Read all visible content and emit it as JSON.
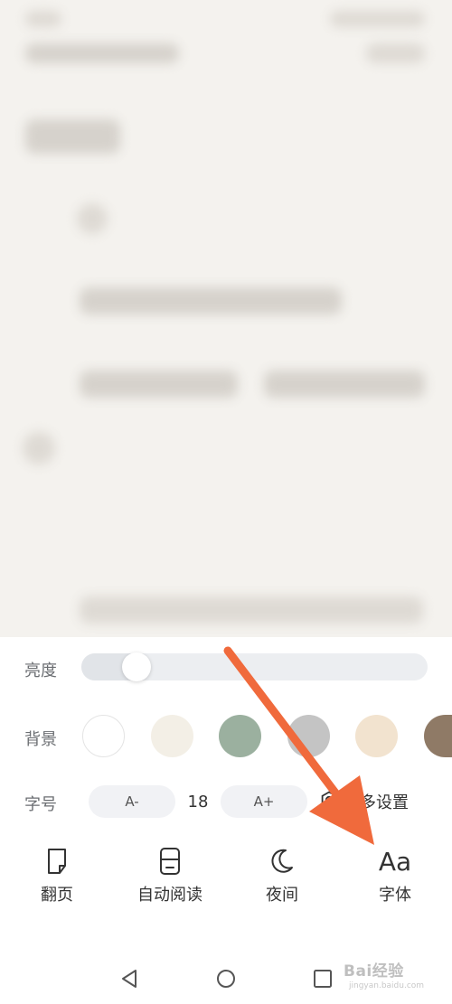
{
  "settings_panel": {
    "brightness": {
      "label": "亮度",
      "level": 0.16
    },
    "background": {
      "label": "背景",
      "swatches": [
        {
          "name": "white",
          "color": "#ffffff",
          "selected": true
        },
        {
          "name": "beige",
          "color": "#f3efe6"
        },
        {
          "name": "green",
          "color": "#9bb09f"
        },
        {
          "name": "gray",
          "color": "#c4c4c4"
        },
        {
          "name": "peach",
          "color": "#f2e3cf"
        },
        {
          "name": "brown",
          "color": "#8f7a66"
        }
      ]
    },
    "font_size": {
      "label": "字号",
      "decrease_label": "A-",
      "value": "18",
      "increase_label": "A+",
      "more_settings_label": "更多设置"
    }
  },
  "bottom_tabs": [
    {
      "label": "翻页",
      "icon": "page-turn-icon"
    },
    {
      "label": "自动阅读",
      "icon": "auto-read-icon"
    },
    {
      "label": "夜间",
      "icon": "moon-icon"
    },
    {
      "label": "字体",
      "icon": "font-icon",
      "glyph": "Aa"
    }
  ],
  "system_nav": {
    "back": "back-icon",
    "home": "home-icon",
    "recents": "recents-icon"
  },
  "annotation": {
    "arrow_color": "#f06a3c"
  },
  "watermark": {
    "text": "Bai经验",
    "subtext": "jingyan.baidu.com"
  }
}
